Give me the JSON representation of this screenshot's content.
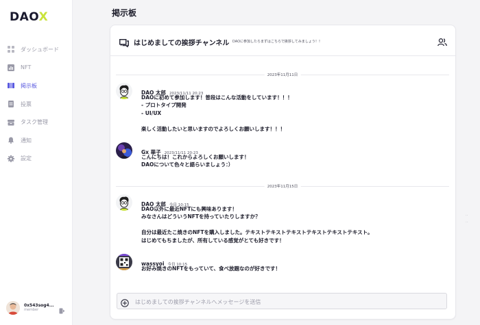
{
  "logo": {
    "text": "DAO",
    "accent": "X"
  },
  "sidebar": {
    "items": [
      {
        "label": "ダッシュボード",
        "icon": "grid-icon"
      },
      {
        "label": "NFT",
        "icon": "image-icon"
      },
      {
        "label": "掲示板",
        "icon": "board-icon",
        "active": true
      },
      {
        "label": "投票",
        "icon": "document-icon"
      },
      {
        "label": "タスク管理",
        "icon": "folder-icon"
      },
      {
        "label": "通知",
        "icon": "bell-icon"
      },
      {
        "label": "設定",
        "icon": "gear-icon"
      }
    ]
  },
  "user": {
    "name": "0x543sog4...",
    "role": "member"
  },
  "page": {
    "title": "掲示板"
  },
  "channel": {
    "name": "はじめましての挨拶チャンネル",
    "description": "DAOに参加したらまずはこちらで挨拶してみましょう！！"
  },
  "timeline": {
    "dates": [
      "2023年11月11日",
      "2023年11月15日"
    ],
    "messages": [
      {
        "author": "DAO 太郎",
        "time": "2023/11/11 20:23",
        "lines": [
          "DAOに初めて参加します！普段はこんな活動をしています！！！",
          "- プロトタイプ開発",
          "- UI/UX",
          "",
          "楽しく活動したいと思いますのでよろしくお願いします！！！"
        ]
      },
      {
        "author": "Gx 華子",
        "time": "2023/11/11 20:23",
        "lines": [
          "こんにちは！これからよろしくお願いします！",
          "DAOについて色々と語らいましょう：）"
        ]
      },
      {
        "author": "DAO 太郎",
        "time": "今日 10:15",
        "lines": [
          "DAO以外に最近NFTにも興味あります！",
          "みなさんはどういうNFTを持っていたりしますか？",
          "",
          "自分は最近たこ焼きのNFTを購入しました。テキストテキストテキストテキストテキストテキスト。",
          "はじめてもちましたが、所有している感覚がとても好きです！"
        ]
      },
      {
        "author": "wassyoi",
        "time": "今日 10:15",
        "lines": [
          "お好み焼きのNFTをもっていて、食べ放題なのが好きです！"
        ]
      }
    ]
  },
  "composer": {
    "placeholder": "はじめましての挨拶チャンネルへメッセージを送信",
    "value": ""
  },
  "colors": {
    "accent": "#5b5be0",
    "logo_x": "#c9e33a",
    "background": "#f4f4f6"
  }
}
